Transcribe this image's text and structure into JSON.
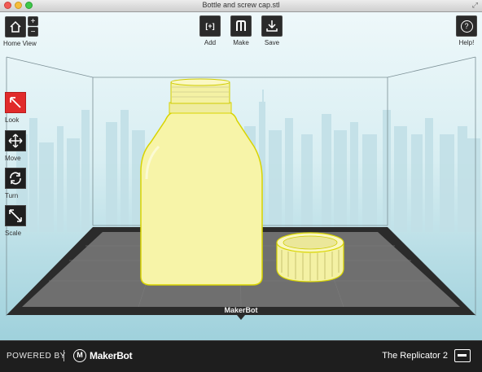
{
  "window": {
    "title": "Bottle and screw cap.stl",
    "resize_glyph": "⤢"
  },
  "toolbar": {
    "home_view_label": "Home View",
    "zoom_in_symbol": "+",
    "zoom_out_symbol": "−",
    "add_label": "Add",
    "add_symbol": "[+]",
    "make_label": "Make",
    "save_label": "Save",
    "help_label": "Help!",
    "help_symbol": "?"
  },
  "side_tools": [
    {
      "label": "Look",
      "icon": "look-arrow-icon",
      "active": true
    },
    {
      "label": "Move",
      "icon": "move-arrows-icon",
      "active": false
    },
    {
      "label": "Turn",
      "icon": "rotate-icon",
      "active": false
    },
    {
      "label": "Scale",
      "icon": "scale-arrow-icon",
      "active": false
    }
  ],
  "build_plate": {
    "brand_text": "MakerBot"
  },
  "footer": {
    "powered_by": "POWERED BY",
    "brand": "MakerBot",
    "printer_name": "The Replicator 2"
  },
  "colors": {
    "accent_active": "#e12b2b",
    "model": "#f7f4a8",
    "plate": "#6f6f6f",
    "background_sky": "#cfe8ee"
  }
}
